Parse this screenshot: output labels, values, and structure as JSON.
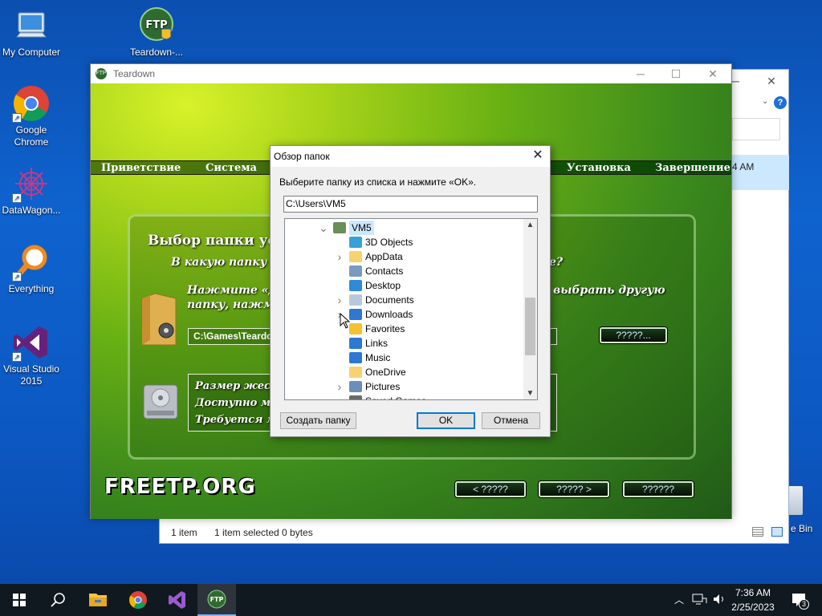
{
  "desktop": {
    "icons": [
      {
        "label": "My Computer"
      },
      {
        "label": "Teardown-..."
      },
      {
        "label": "Google Chrome"
      },
      {
        "label": "DataWagon..."
      },
      {
        "label": "Everything"
      },
      {
        "label": "Visual Studio 2015"
      },
      {
        "label": "e Bin"
      }
    ]
  },
  "explorer": {
    "time_fragment": "4 AM",
    "status": {
      "items": "1 item",
      "selected": "1 item selected  0 bytes"
    }
  },
  "installer": {
    "title": "Teardown",
    "nav": [
      "Приветствие",
      "Система",
      "Установка",
      "Завершение"
    ],
    "heading": "Выбор папки ус",
    "question": "В какую папку В",
    "question_end": "е?",
    "instruction_left": "Нажмите «Д",
    "instruction_left2": "папку, нажм",
    "instruction_right": "выбрать другую",
    "path_value": "C:\\Games\\Teardo",
    "browse_button": "?????...",
    "disk_info": [
      "Размер жест",
      "Доступно ме",
      "Требуется ме"
    ],
    "logo_text": "FREETP.ORG",
    "back_button": "< ?????",
    "next_button": "????? >",
    "cancel_button": "??????"
  },
  "dialog": {
    "title": "Обзор папок",
    "prompt": "Выберите папку из списка и нажмите «OK».",
    "path": "C:\\Users\\VM5",
    "tree": [
      {
        "label": "VM5",
        "level": 0,
        "expand": "v",
        "icon": "user-folder-icon"
      },
      {
        "label": "3D Objects",
        "level": 1,
        "expand": "",
        "icon": "3d-objects-icon"
      },
      {
        "label": "AppData",
        "level": 1,
        "expand": ">",
        "icon": "folder-icon"
      },
      {
        "label": "Contacts",
        "level": 1,
        "expand": "",
        "icon": "contacts-icon"
      },
      {
        "label": "Desktop",
        "level": 1,
        "expand": "",
        "icon": "desktop-icon"
      },
      {
        "label": "Documents",
        "level": 1,
        "expand": ">",
        "icon": "documents-icon"
      },
      {
        "label": "Downloads",
        "level": 1,
        "expand": ">",
        "icon": "downloads-icon"
      },
      {
        "label": "Favorites",
        "level": 1,
        "expand": "",
        "icon": "favorites-icon"
      },
      {
        "label": "Links",
        "level": 1,
        "expand": "",
        "icon": "links-icon"
      },
      {
        "label": "Music",
        "level": 1,
        "expand": "",
        "icon": "music-icon"
      },
      {
        "label": "OneDrive",
        "level": 1,
        "expand": "",
        "icon": "folder-icon"
      },
      {
        "label": "Pictures",
        "level": 1,
        "expand": ">",
        "icon": "pictures-icon"
      },
      {
        "label": "Saved Games",
        "level": 1,
        "expand": "",
        "icon": "saved-games-icon"
      }
    ],
    "buttons": {
      "new_folder": "Создать папку",
      "ok": "OK",
      "cancel": "Отмена"
    }
  },
  "taskbar": {
    "time": "7:36 AM",
    "date": "2/25/2023",
    "notification_count": "3"
  }
}
